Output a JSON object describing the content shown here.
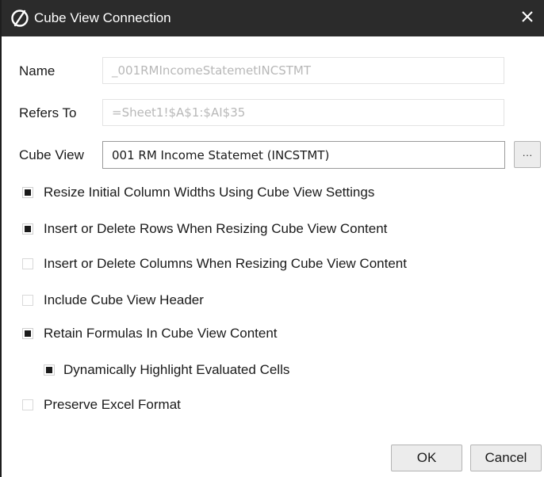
{
  "window": {
    "title": "Cube View Connection",
    "close_glyph": "✕",
    "logo_icon": "onestream-logo-icon"
  },
  "fields": {
    "name": {
      "label": "Name",
      "value": "_001RMIncomeStatemetINCSTMT"
    },
    "refers_to": {
      "label": "Refers To",
      "value": "=Sheet1!$A$1:$AI$35"
    },
    "cube_view": {
      "label": "Cube View",
      "value": "001 RM Income Statemet (INCSTMT)",
      "browse_label": "···"
    }
  },
  "options": [
    {
      "label": "Resize Initial Column Widths Using Cube View Settings",
      "checked": true
    },
    {
      "label": "Insert or Delete Rows When Resizing Cube View Content",
      "checked": true
    },
    {
      "label": "Insert or Delete Columns When Resizing Cube View Content",
      "checked": false
    },
    {
      "label": "Include Cube View Header",
      "checked": false
    },
    {
      "label": "Retain Formulas In Cube View Content",
      "checked": true
    },
    {
      "label": "Dynamically Highlight Evaluated Cells",
      "checked": true
    },
    {
      "label": "Preserve Excel Format",
      "checked": false
    }
  ],
  "buttons": {
    "ok": "OK",
    "cancel": "Cancel"
  },
  "colors": {
    "titlebar": "#2b2b2b",
    "check_fill": "#1a1a1a",
    "disabled_text": "#b8b8b8"
  }
}
